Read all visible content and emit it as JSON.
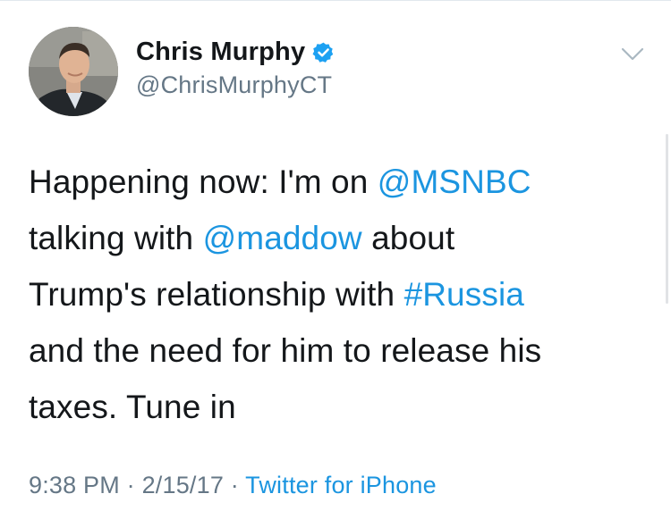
{
  "author": {
    "display_name": "Chris Murphy",
    "handle": "@ChrisMurphyCT",
    "verified": true,
    "avatar_icon": "person-avatar"
  },
  "menu": {
    "icon": "chevron-down-icon"
  },
  "tweet": {
    "lines": [
      [
        {
          "text": "Happening now: I'm on ",
          "type": "text"
        },
        {
          "text": "@MSNBC",
          "type": "mention"
        }
      ],
      [
        {
          "text": "talking with ",
          "type": "text"
        },
        {
          "text": "@maddow",
          "type": "mention"
        },
        {
          "text": " about",
          "type": "text"
        }
      ],
      [
        {
          "text": "Trump's relationship with ",
          "type": "text"
        },
        {
          "text": "#Russia",
          "type": "hashtag"
        }
      ],
      [
        {
          "text": "and the need for him to release his",
          "type": "text"
        }
      ],
      [
        {
          "text": "taxes. Tune in",
          "type": "text"
        }
      ]
    ]
  },
  "meta": {
    "time": "9:38 PM",
    "separator1": " · ",
    "date": "2/15/17",
    "separator2": " · ",
    "source": "Twitter for iPhone"
  },
  "colors": {
    "link": "#1b95e0",
    "secondary": "#657786",
    "primary_text": "#14171a",
    "verified_badge": "#1da1f2"
  }
}
